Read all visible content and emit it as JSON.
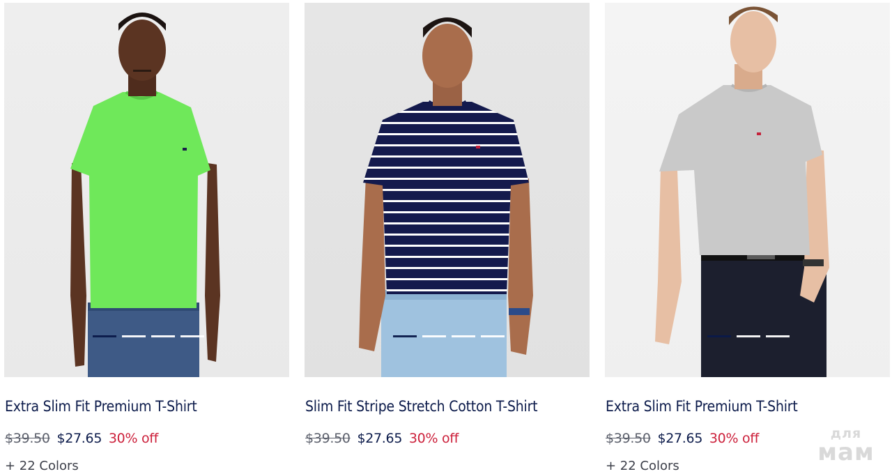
{
  "products": [
    {
      "title": "Extra Slim Fit Premium T-Shirt",
      "old_price": "$39.50",
      "new_price": "$27.65",
      "discount": "30% off",
      "colors": "+ 22 Colors",
      "shirt_color": "#6fe85a",
      "image_dots": 4,
      "active_dot": 0
    },
    {
      "title": "Slim Fit Stripe Stretch Cotton T-Shirt",
      "old_price": "$39.50",
      "new_price": "$27.65",
      "discount": "30% off",
      "colors": "",
      "shirt_color": "#141a4d",
      "image_dots": 4,
      "active_dot": 0
    },
    {
      "title": "Extra Slim Fit Premium T-Shirt",
      "old_price": "$39.50",
      "new_price": "$27.65",
      "discount": "30% off",
      "colors": "+ 22 Colors",
      "shirt_color": "#c9c9c9",
      "image_dots": 3,
      "active_dot": 0
    }
  ],
  "watermark": {
    "line1": "для",
    "line2": "мам"
  },
  "colors": {
    "title": "#0b1a4a",
    "sale": "#cc1f3a",
    "old_price": "#5b5f6b"
  }
}
